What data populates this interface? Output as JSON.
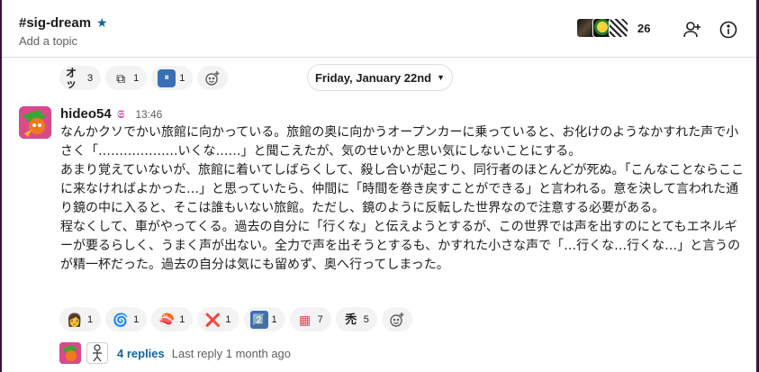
{
  "header": {
    "channel_name": "#sig-dream",
    "topic_placeholder": "Add a topic",
    "member_count": "26"
  },
  "top_reactions": [
    {
      "emoji": "オッ",
      "count": "3"
    },
    {
      "emoji": "⧉",
      "count": "1"
    },
    {
      "emoji": "⏸",
      "count": "1"
    }
  ],
  "date_divider": {
    "label": "Friday, January 22nd"
  },
  "message": {
    "author": "hideo54",
    "badge": "𝕾",
    "time": "13:46",
    "lines": [
      "なんかクソでかい旅館に向かっている。旅館の奥に向かうオープンカーに乗っていると、お化けのようなかすれた声で小さく「……………….いくな……」と聞こえたが、気のせいかと思い気にしないことにする。",
      "あまり覚えていないが、旅館に着いてしばらくして、殺し合いが起こり、同行者のほとんどが死ぬ。「こんなことならここに来なければよかった…」と思っていたら、仲間に「時間を巻き戻すことができる」と言われる。意を決して言われた通り鏡の中に入ると、そこは誰もいない旅館。ただし、鏡のように反転した世界なので注意する必要がある。",
      "程なくして、車がやってくる。過去の自分に「行くな」と伝えようとするが、この世界では声を出すのにとてもエネルギーが要るらしく、うまく声が出ない。全力で声を出そうとするも、かすれた小さな声で「…行くな…行くな…」と言うのが精一杯だった。過去の自分は気にも留めず、奥へ行ってしまった。"
    ],
    "reactions": [
      {
        "emoji": "👩",
        "count": "1"
      },
      {
        "emoji": "🌀",
        "count": "1"
      },
      {
        "emoji": "🍣",
        "count": "1"
      },
      {
        "emoji": "❌",
        "count": "1"
      },
      {
        "emoji": "2️⃣",
        "count": "1"
      },
      {
        "emoji": "▦",
        "count": "7"
      },
      {
        "emoji": "禿",
        "count": "5"
      }
    ]
  },
  "thread": {
    "replies": "4 replies",
    "last_reply": "Last reply 1 month ago"
  },
  "colors": {
    "link": "#1264a3",
    "sidebar": "#3f0e40",
    "reaction_bg": "#f3f3f3"
  }
}
